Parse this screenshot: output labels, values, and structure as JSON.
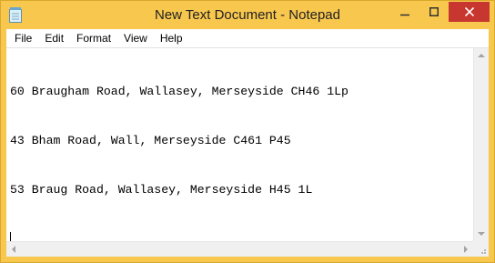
{
  "window": {
    "title": "New Text Document - Notepad",
    "frame_color": "#f8c74e",
    "close_button_color": "#c7372f",
    "app_icon": "notepad-icon"
  },
  "menu": {
    "items": [
      {
        "label": "File"
      },
      {
        "label": "Edit"
      },
      {
        "label": "Format"
      },
      {
        "label": "View"
      },
      {
        "label": "Help"
      }
    ]
  },
  "document": {
    "lines": [
      "60 Braugham Road, Wallasey, Merseyside CH46 1Lp",
      "43 Bham Road, Wall, Merseyside C461 P45",
      "53 Braug Road, Wallasey, Merseyside H45 1L",
      ""
    ]
  }
}
